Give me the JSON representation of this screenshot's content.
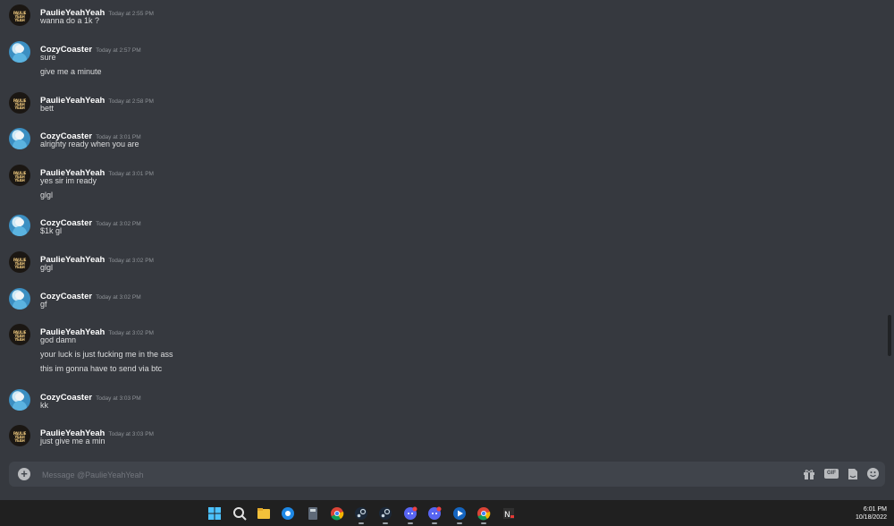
{
  "messages": [
    {
      "author": "PaulieYeahYeah",
      "avatar": "paulie",
      "time": "Today at 2:55 PM",
      "lines": [
        "wanna do a 1k ?"
      ]
    },
    {
      "author": "CozyCoaster",
      "avatar": "cozy",
      "time": "Today at 2:57 PM",
      "lines": [
        "sure",
        "give me a minute"
      ]
    },
    {
      "author": "PaulieYeahYeah",
      "avatar": "paulie",
      "time": "Today at 2:58 PM",
      "lines": [
        "bett"
      ]
    },
    {
      "author": "CozyCoaster",
      "avatar": "cozy",
      "time": "Today at 3:01 PM",
      "lines": [
        "alrighty ready when you are"
      ]
    },
    {
      "author": "PaulieYeahYeah",
      "avatar": "paulie",
      "time": "Today at 3:01 PM",
      "lines": [
        "yes sir im ready",
        "glgl"
      ]
    },
    {
      "author": "CozyCoaster",
      "avatar": "cozy",
      "time": "Today at 3:02 PM",
      "lines": [
        "$1k gl"
      ]
    },
    {
      "author": "PaulieYeahYeah",
      "avatar": "paulie",
      "time": "Today at 3:02 PM",
      "lines": [
        "glgl"
      ]
    },
    {
      "author": "CozyCoaster",
      "avatar": "cozy",
      "time": "Today at 3:02 PM",
      "lines": [
        "gf"
      ]
    },
    {
      "author": "PaulieYeahYeah",
      "avatar": "paulie",
      "time": "Today at 3:02 PM",
      "lines": [
        "god damn",
        "your luck is just fucking me in the ass",
        "this im gonna have to send via btc"
      ]
    },
    {
      "author": "CozyCoaster",
      "avatar": "cozy",
      "time": "Today at 3:03 PM",
      "lines": [
        "kk"
      ]
    },
    {
      "author": "PaulieYeahYeah",
      "avatar": "paulie",
      "time": "Today at 3:03 PM",
      "lines": [
        "just give me a min"
      ]
    }
  ],
  "avatar_text": {
    "paulie": "PAULIE YEAH YEAH"
  },
  "composer": {
    "placeholder": "Message @PaulieYeahYeah"
  },
  "taskbar": {
    "icons": [
      "windows-start-icon",
      "search-icon",
      "file-explorer-icon",
      "browser-icon",
      "calculator-icon",
      "chrome-icon",
      "steam-icon",
      "steam-icon",
      "discord-icon",
      "discord-icon",
      "media-player-icon",
      "chrome-icon",
      "app-icon"
    ],
    "clock": {
      "time": "6:01 PM",
      "date": "10/18/2022"
    }
  },
  "colors": {
    "background": "#36393f",
    "composer": "#40444b",
    "taskbar": "#202020",
    "author": "#ffffff",
    "text": "#dcddde",
    "timestamp": "#8e9297"
  }
}
